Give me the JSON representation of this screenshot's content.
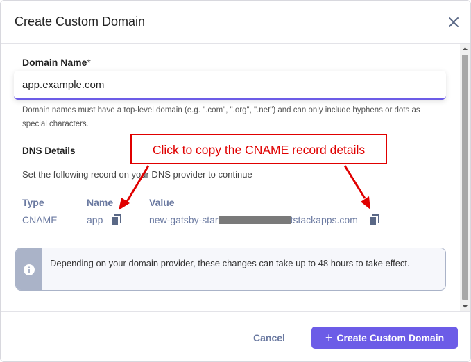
{
  "dialog": {
    "title": "Create Custom Domain",
    "close_icon": "close-icon"
  },
  "domain": {
    "label": "Domain Name",
    "required_mark": "*",
    "value": "app.example.com",
    "help": "Domain names must have a top-level domain (e.g. \".com\", \".org\", \".net\") and can only include hyphens or dots as special characters."
  },
  "dns": {
    "title": "DNS Details",
    "instructions": "Set the following record on your DNS provider to continue",
    "columns": {
      "type": "Type",
      "name": "Name",
      "value": "Value"
    },
    "record": {
      "type": "CNAME",
      "name": "app",
      "value_start": "new-gatsby-star",
      "value_end": "tstackapps.com"
    }
  },
  "info": {
    "text": "Depending on your domain provider, these changes can take up to 48 hours to take effect."
  },
  "footer": {
    "cancel_label": "Cancel",
    "create_label": "Create Custom Domain"
  },
  "annotation": {
    "text": "Click to copy the CNAME record details"
  },
  "colors": {
    "accent": "#6c5ce7",
    "muted_text": "#6b7aa1",
    "annotation_red": "#e00000"
  }
}
